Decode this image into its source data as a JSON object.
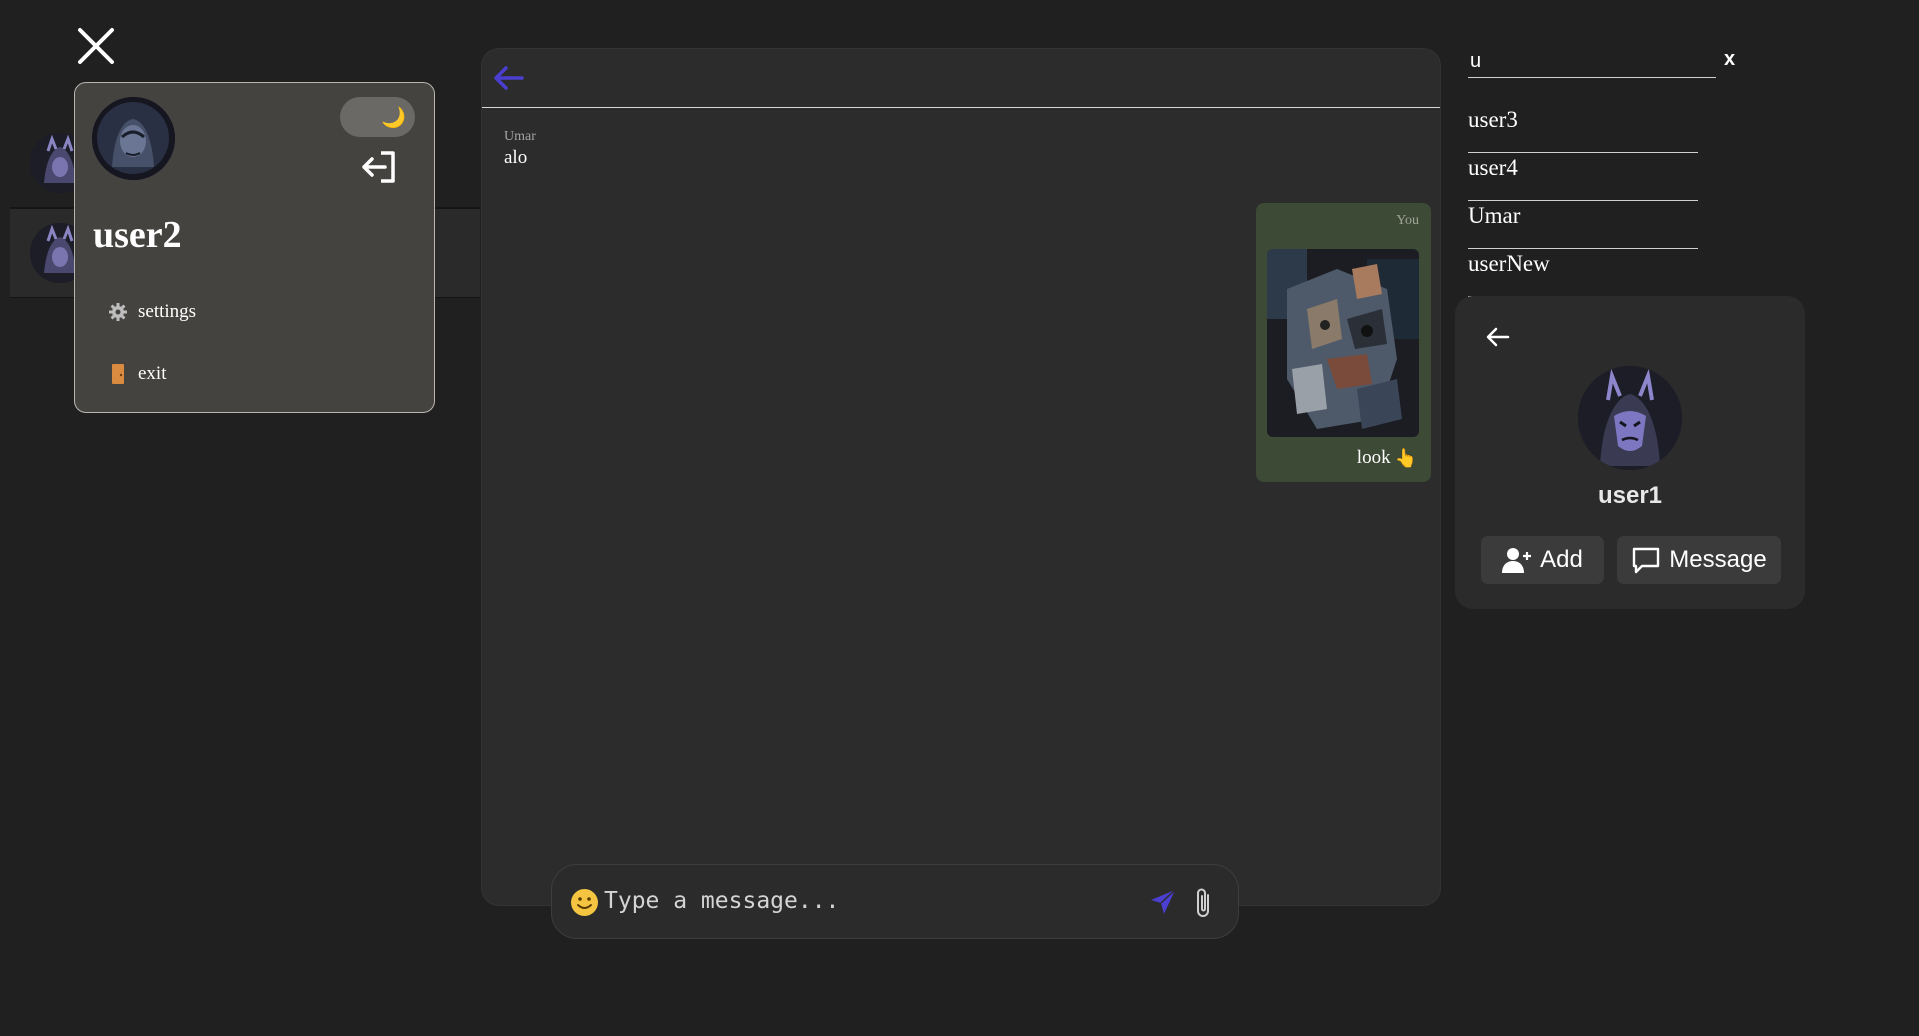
{
  "sidebar": {
    "close_icon": "close-icon",
    "profile_menu": {
      "username": "user2",
      "theme_icon": "moon-icon",
      "items": [
        {
          "label": "settings",
          "icon": "gear-icon"
        },
        {
          "label": "exit",
          "icon": "door-icon"
        }
      ]
    }
  },
  "chat": {
    "messages": [
      {
        "sender": "Umar",
        "text": "alo",
        "direction": "in"
      },
      {
        "sender": "You",
        "text": "look",
        "emoji": "👆",
        "direction": "out",
        "has_image": true
      }
    ],
    "input": {
      "placeholder": "Type a message..."
    },
    "colors": {
      "outgoing_bubble": "#3d4a35",
      "accent": "#4a3fd0"
    }
  },
  "search": {
    "query": "u",
    "clear_label": "x",
    "results": [
      "user3",
      "user4",
      "Umar",
      "userNew"
    ]
  },
  "user_card": {
    "username": "user1",
    "add_label": "Add",
    "message_label": "Message"
  }
}
